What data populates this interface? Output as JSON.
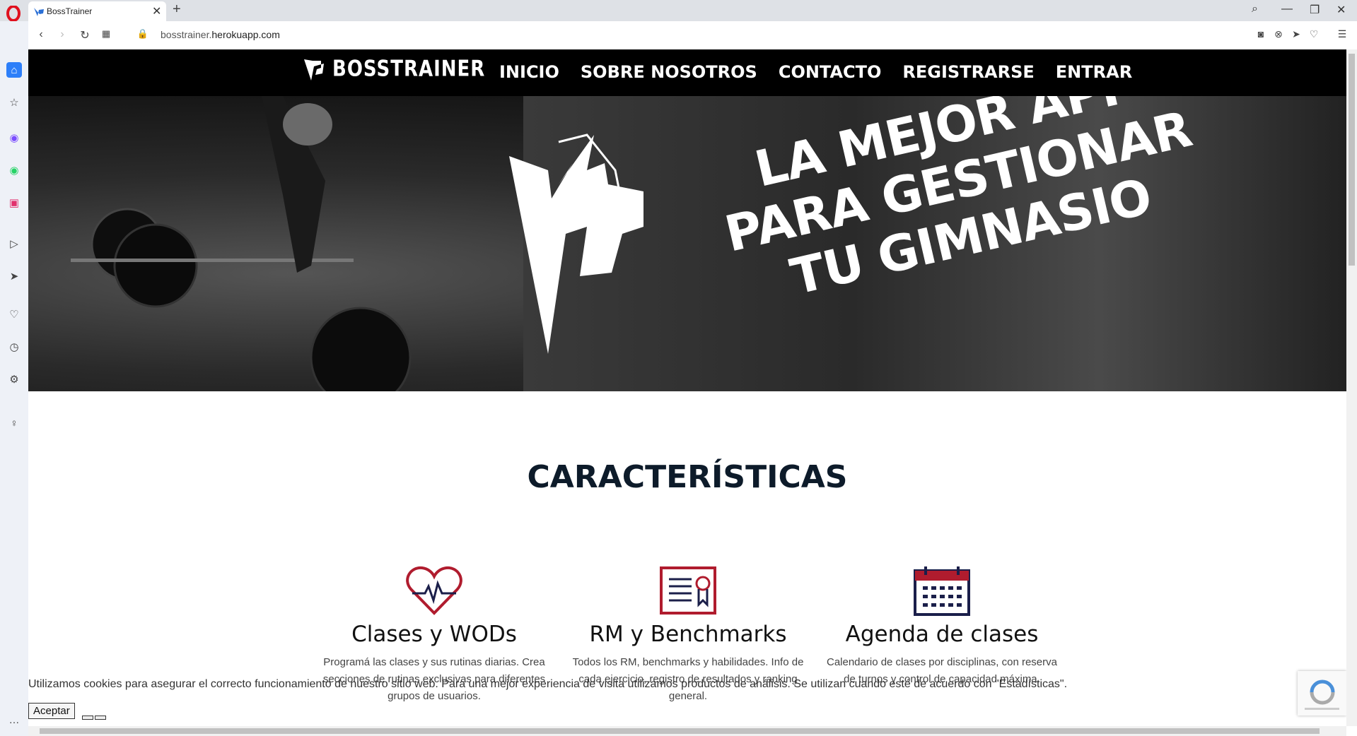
{
  "browser": {
    "tab_title": "BossTrainer",
    "url_host": "bosstrainer.",
    "url_domain": "herokuapp.com"
  },
  "site": {
    "brand": "BOSSTRAINER",
    "menu": [
      "INICIO",
      "SOBRE NOSOTROS",
      "CONTACTO",
      "REGISTRARSE",
      "ENTRAR"
    ],
    "hero_lines": [
      "LA MEJOR APP",
      "PARA GESTIONAR",
      "TU GIMNASIO"
    ],
    "features_title": "CARACTERÍSTICAS",
    "features": [
      {
        "title": "Clases y WODs",
        "desc": "Programá las clases y sus rutinas diarias. Crea secciones de rutinas exclusivas para diferentes grupos de usuarios.",
        "icon": "heart-pulse-icon"
      },
      {
        "title": "RM y Benchmarks",
        "desc": "Todos los RM, benchmarks y habilidades. Info de cada ejercicio, registro de resultados y ranking general.",
        "icon": "certificate-icon"
      },
      {
        "title": "Agenda de clases",
        "desc": "Calendario de clases por disciplinas, con reserva de turnos y control de capacidad máxima.",
        "icon": "calendar-icon"
      }
    ],
    "cookie_text": "Utilizamos cookies para asegurar el correcto funcionamiento de nuestro sitio web. Para una mejor experiencia de visita utilizamos productos de análisis. Se utilizan cuando esté de acuerdo con \"Estadísticas\".",
    "accept_label": "Aceptar"
  },
  "colors": {
    "accent_red": "#b01c2e",
    "accent_navy": "#1b1f4a",
    "title_navy": "#0d1b2a"
  }
}
